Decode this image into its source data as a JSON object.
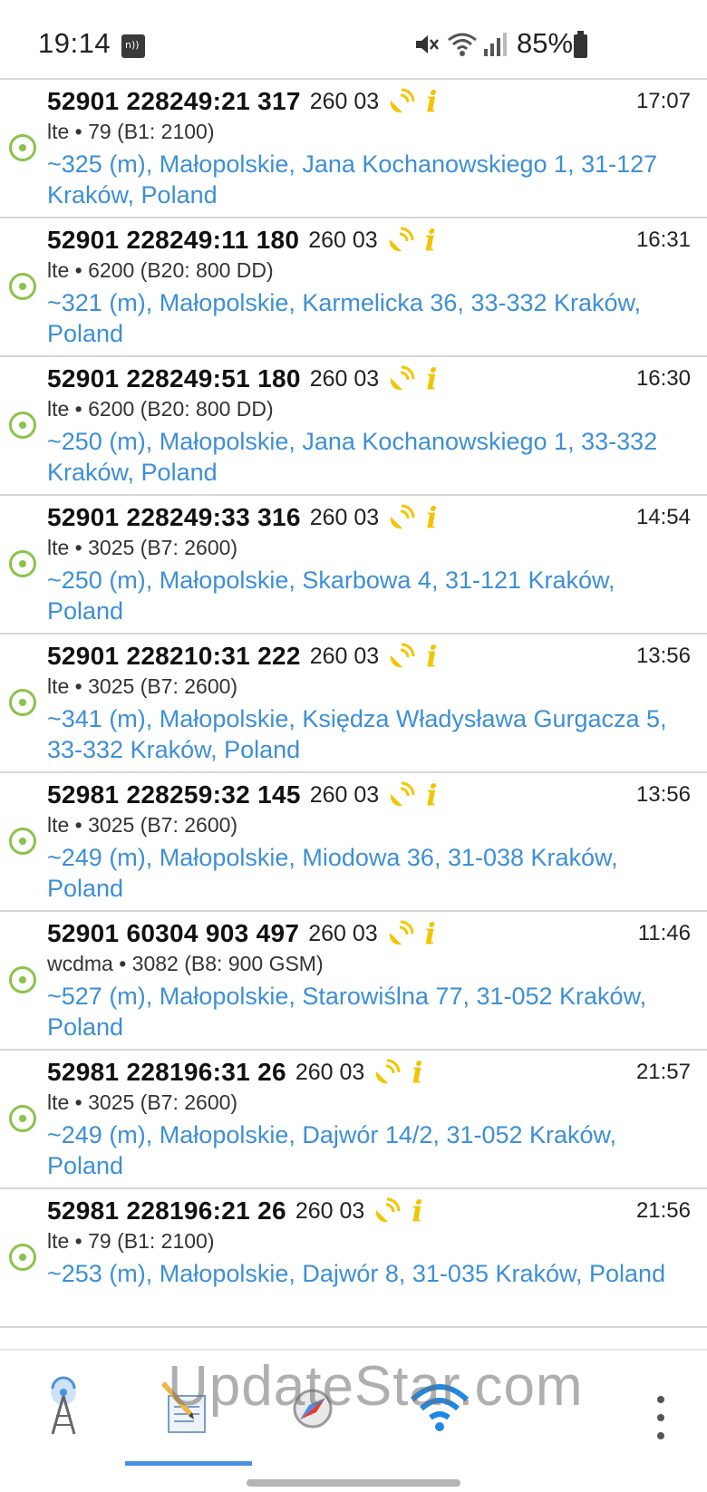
{
  "status_bar": {
    "time": "19:14",
    "battery": "85%",
    "icons": [
      "nfc-icon",
      "mute-icon",
      "wifi-icon",
      "signal-icon",
      "battery-icon"
    ]
  },
  "rows": [
    {
      "cell_id": "52901 228249:21 317",
      "mcc_mnc": "260 03",
      "time": "17:07",
      "tech": "lte • 79 (B1: 2100)",
      "address": "~325 (m), Małopolskie, Jana Kochanowskiego 1, 31-127 Kraków, Poland"
    },
    {
      "cell_id": "52901 228249:11 180",
      "mcc_mnc": "260 03",
      "time": "16:31",
      "tech": "lte • 6200 (B20: 800 DD)",
      "address": "~321 (m), Małopolskie, Karmelicka 36, 33-332 Kraków, Poland"
    },
    {
      "cell_id": "52901 228249:51 180",
      "mcc_mnc": "260 03",
      "time": "16:30",
      "tech": "lte • 6200 (B20: 800 DD)",
      "address": "~250 (m), Małopolskie, Jana Kochanowskiego 1, 33-332 Kraków, Poland"
    },
    {
      "cell_id": "52901 228249:33 316",
      "mcc_mnc": "260 03",
      "time": "14:54",
      "tech": "lte • 3025 (B7: 2600)",
      "address": "~250 (m), Małopolskie, Skarbowa 4, 31-121 Kraków, Poland"
    },
    {
      "cell_id": "52901 228210:31 222",
      "mcc_mnc": "260 03",
      "time": "13:56",
      "tech": "lte • 3025 (B7: 2600)",
      "address": "~341 (m), Małopolskie, Księdza Władysława Gurgacza 5, 33-332 Kraków, Poland"
    },
    {
      "cell_id": "52981 228259:32 145",
      "mcc_mnc": "260 03",
      "time": "13:56",
      "tech": "lte • 3025 (B7: 2600)",
      "address": "~249 (m), Małopolskie, Miodowa 36, 31-038 Kraków, Poland"
    },
    {
      "cell_id": "52901 60304 903 497",
      "mcc_mnc": "260 03",
      "time": "11:46",
      "tech": "wcdma • 3082 (B8: 900 GSM)",
      "address": "~527 (m), Małopolskie, Starowiślna 77, 31-052 Kraków, Poland"
    },
    {
      "cell_id": "52981 228196:31 26",
      "mcc_mnc": "260 03",
      "time": "21:57",
      "tech": "lte • 3025 (B7: 2600)",
      "address": "~249 (m), Małopolskie, Dajwór 14/2, 31-052 Kraków, Poland"
    },
    {
      "cell_id": "52981 228196:21 26",
      "mcc_mnc": "260 03",
      "time": "21:56",
      "tech": "lte • 79 (B1: 2100)",
      "address": "~253 (m), Małopolskie, Dajwór 8, 31-035 Kraków, Poland"
    }
  ],
  "bottom_nav": {
    "tabs": [
      "cell-tower-icon",
      "log-icon",
      "compass-icon",
      "wifi-icon"
    ],
    "active_tab": "log-icon"
  },
  "watermark": "UpdateStar.com",
  "colors": {
    "accent": "#4a90e2",
    "address": "#3d8fd6",
    "marker": "#8bc34a",
    "icon_yellow": "#f2c500"
  }
}
